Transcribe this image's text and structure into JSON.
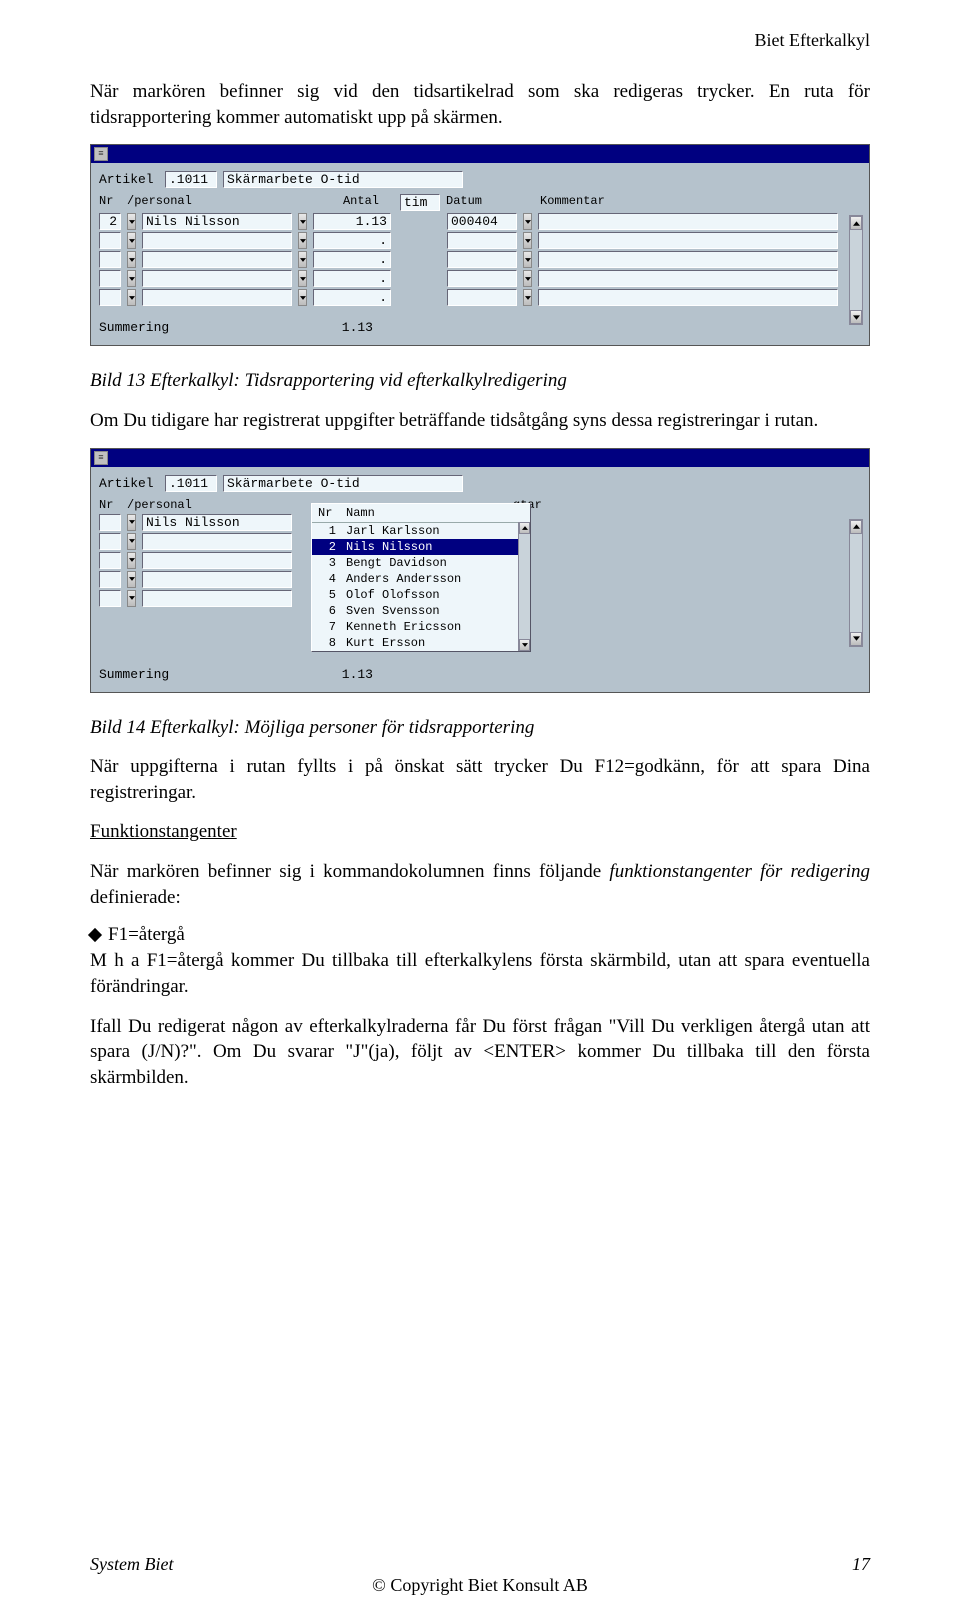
{
  "header_right": "Biet Efterkalkyl",
  "intro_para": "När markören befinner sig vid den tidsartikelrad som ska redigeras trycker. En ruta för tidsrapportering kommer automatiskt upp på skärmen.",
  "app1": {
    "labels": {
      "artikel": "Artikel",
      "summering": "Summering"
    },
    "article_code": ".1011",
    "article_name": "Skärmarbete O-tid",
    "columns": {
      "nr": "Nr",
      "personal": "/personal",
      "antal": "Antal",
      "unit": "tim",
      "datum": "Datum",
      "kommentar": "Kommentar"
    },
    "rows": [
      {
        "nr": "2",
        "personal": "Nils Nilsson",
        "antal": "1.13",
        "datum": "000404",
        "kommentar": ""
      },
      {
        "nr": "",
        "personal": "",
        "antal": ".",
        "datum": "",
        "kommentar": ""
      },
      {
        "nr": "",
        "personal": "",
        "antal": ".",
        "datum": "",
        "kommentar": ""
      },
      {
        "nr": "",
        "personal": "",
        "antal": ".",
        "datum": "",
        "kommentar": ""
      },
      {
        "nr": "",
        "personal": "",
        "antal": ".",
        "datum": "",
        "kommentar": ""
      }
    ],
    "sum_value": "1.13"
  },
  "caption1": "Bild 13 Efterkalkyl: Tidsrapportering vid efterkalkylredigering",
  "para_after1": "Om Du tidigare har registrerat uppgifter beträffande tidsåtgång syns dessa registreringar i rutan.",
  "app2": {
    "labels": {
      "artikel": "Artikel",
      "summering": "Summering"
    },
    "article_code": ".1011",
    "article_name": "Skärmarbete O-tid",
    "columns": {
      "nr": "Nr",
      "personal": "/personal",
      "gtar": "gtar"
    },
    "left_row_personal": "Nils Nilsson",
    "popup_header": {
      "nr": "Nr",
      "namn": "Namn"
    },
    "popup_rows": [
      {
        "nr": "1",
        "namn": "Jarl Karlsson",
        "sel": false
      },
      {
        "nr": "2",
        "namn": "Nils Nilsson",
        "sel": true
      },
      {
        "nr": "3",
        "namn": "Bengt Davidson",
        "sel": false
      },
      {
        "nr": "4",
        "namn": "Anders Andersson",
        "sel": false
      },
      {
        "nr": "5",
        "namn": "Olof Olofsson",
        "sel": false
      },
      {
        "nr": "6",
        "namn": "Sven Svensson",
        "sel": false
      },
      {
        "nr": "7",
        "namn": "Kenneth Ericsson",
        "sel": false
      },
      {
        "nr": "8",
        "namn": "Kurt Ersson",
        "sel": false
      }
    ],
    "sum_value": "1.13"
  },
  "caption2": "Bild 14 Efterkalkyl: Möjliga personer för tidsrapportering",
  "para_after2": "När uppgifterna i rutan fyllts i på önskat sätt trycker Du F12=godkänn, för att spara Dina registreringar.",
  "funktion_heading": "Funktionstangenter",
  "para_funktion_lead": "När markören befinner sig i kommandokolumnen finns följande ",
  "para_funktion_ital": "funktionstangenter för redigering",
  "para_funktion_tail": " definierade:",
  "bullet1": "F1=återgå",
  "para_b1a": "M h a F1=återgå kommer Du tillbaka till efterkalkylens första skärmbild, utan att spara eventuella förändringar.",
  "para_b1b": "Ifall Du redigerat någon av efterkalkylraderna får Du först frågan \"Vill Du verkligen återgå utan att spara (J/N)?\". Om Du svarar \"J\"(ja), följt av <ENTER> kommer Du tillbaka till den första skärmbilden.",
  "footer": {
    "left": "System Biet",
    "right": "17",
    "center": "© Copyright Biet Konsult AB"
  }
}
